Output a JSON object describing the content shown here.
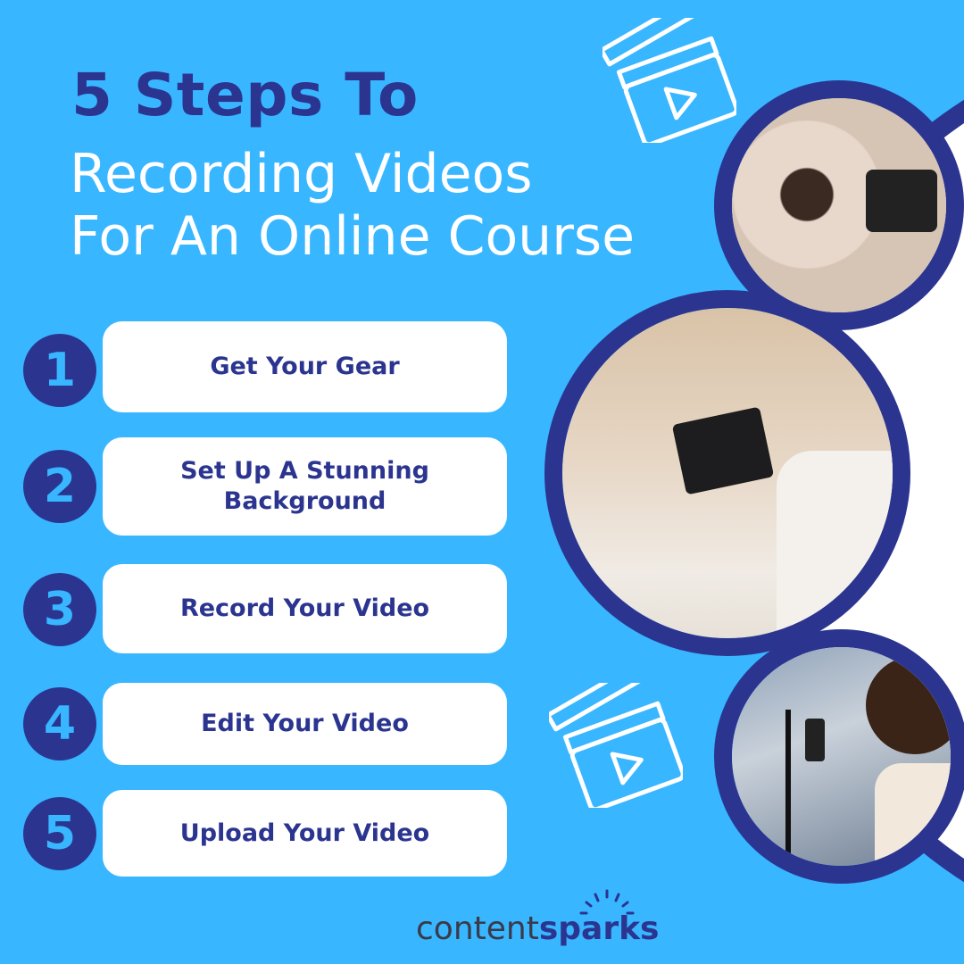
{
  "title": {
    "line1": "5 Steps To",
    "line2": "Recording Videos",
    "line3": "For An Online Course"
  },
  "steps": [
    {
      "number": "1",
      "label": "Get Your Gear"
    },
    {
      "number": "2",
      "label": "Set Up A Stunning Background"
    },
    {
      "number": "3",
      "label": "Record Your Video"
    },
    {
      "number": "4",
      "label": "Edit Your Video"
    },
    {
      "number": "5",
      "label": "Upload Your Video"
    }
  ],
  "photos": [
    {
      "name": "woman-recording-with-dslr-camera"
    },
    {
      "name": "camera-rig-with-monitor-filming-florist"
    },
    {
      "name": "woman-recording-with-phone-on-tripod"
    }
  ],
  "logo": {
    "part1": "content",
    "part2": "sparks"
  },
  "colors": {
    "background": "#38b6ff",
    "navy": "#2b3590",
    "white": "#ffffff"
  }
}
